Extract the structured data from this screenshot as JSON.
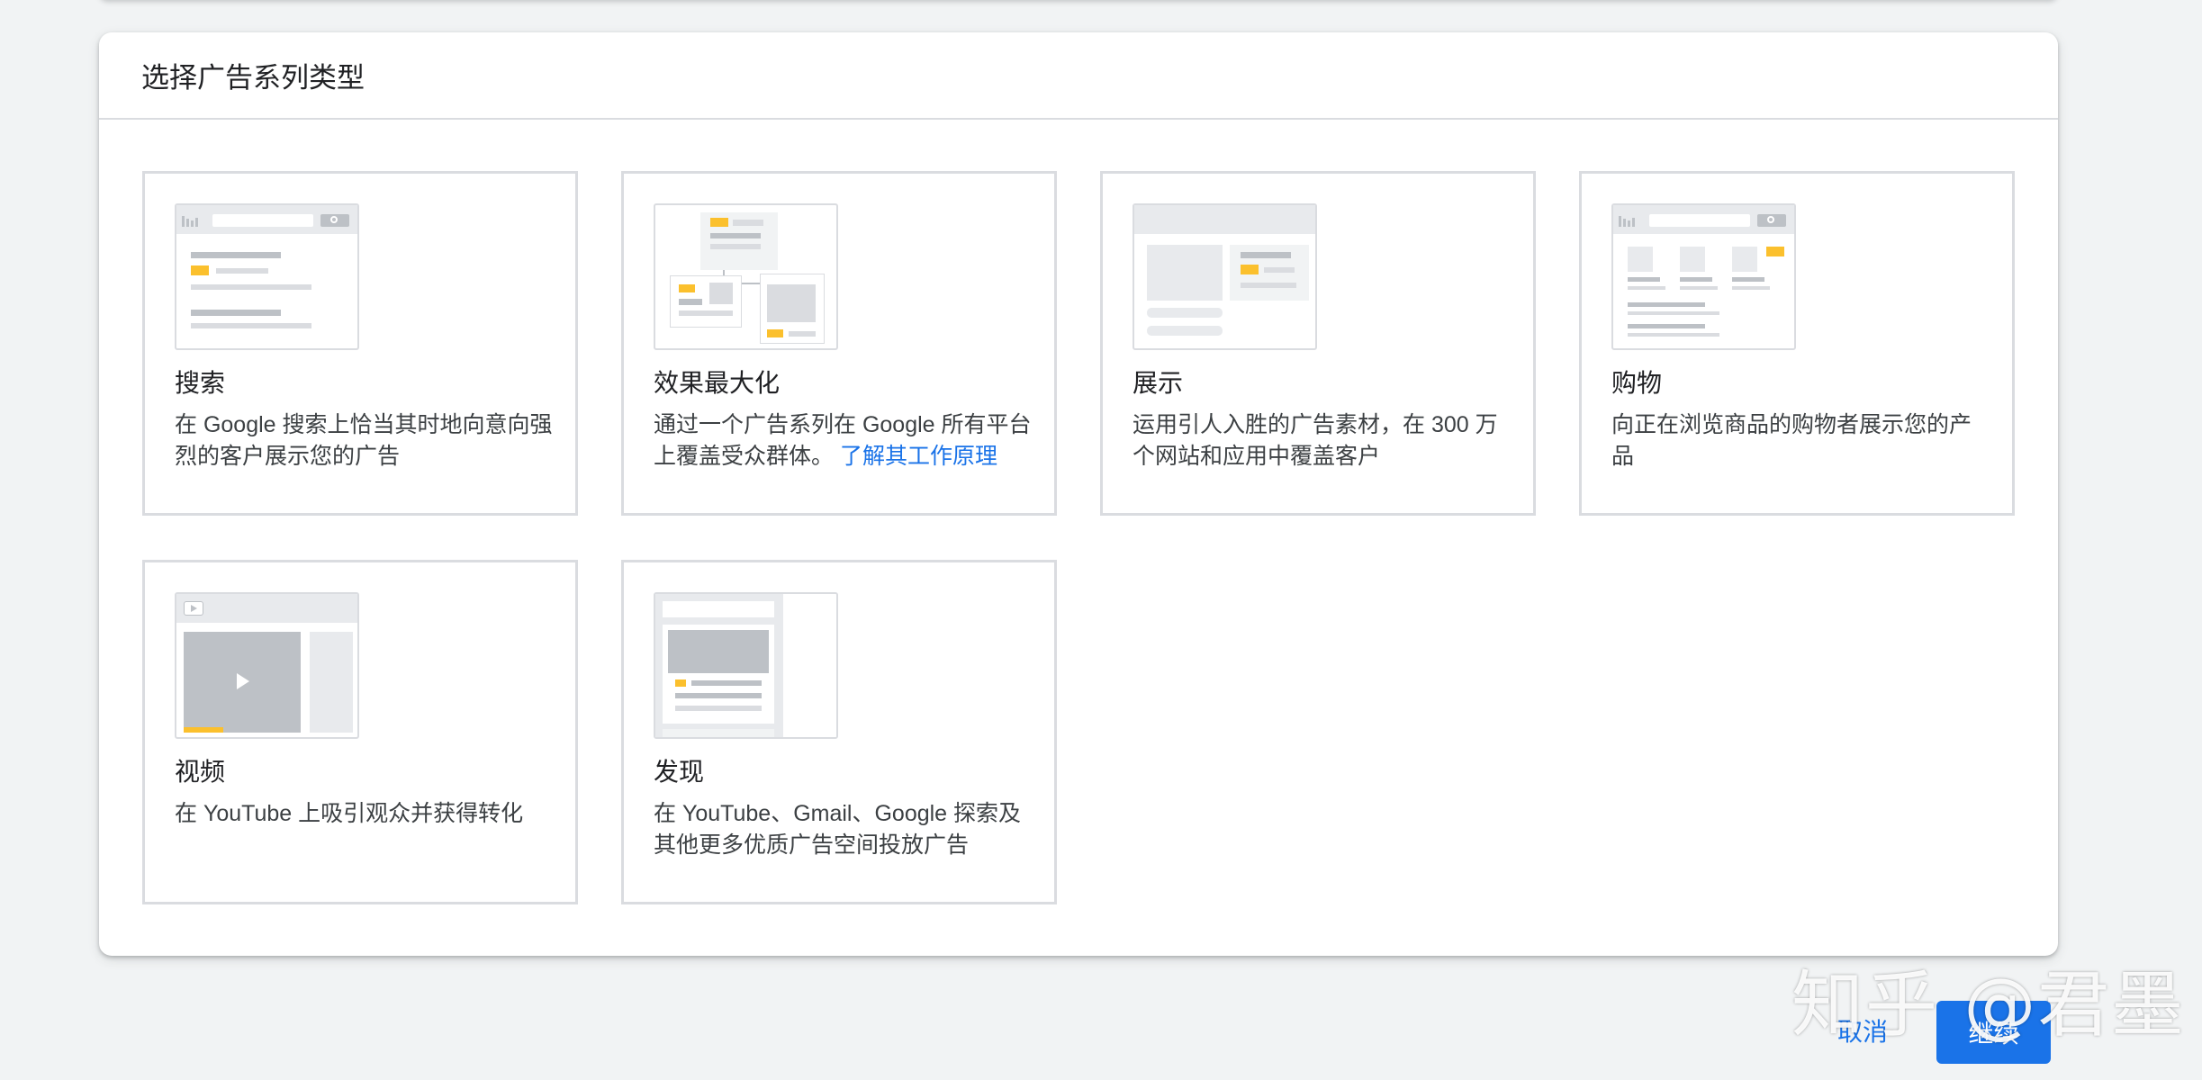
{
  "dialog": {
    "title": "选择广告系列类型"
  },
  "campaign_types": [
    {
      "title": "搜索",
      "description": "在 Google 搜索上恰当其时地向意向强烈的客户展示您的广告",
      "icon": "search-campaign-illustration"
    },
    {
      "title": "效果最大化",
      "description": "通过一个广告系列在 Google 所有平台上覆盖受众群体。",
      "link": "了解其工作原理",
      "icon": "performance-max-illustration"
    },
    {
      "title": "展示",
      "description": "运用引人入胜的广告素材，在 300 万个网站和应用中覆盖客户",
      "icon": "display-campaign-illustration"
    },
    {
      "title": "购物",
      "description": "向正在浏览商品的购物者展示您的产品",
      "icon": "shopping-campaign-illustration"
    },
    {
      "title": "视频",
      "description": "在 YouTube 上吸引观众并获得转化",
      "icon": "video-campaign-illustration"
    },
    {
      "title": "发现",
      "description": "在 YouTube、Gmail、Google 探索及其他更多优质广告空间投放广告",
      "icon": "discovery-campaign-illustration"
    }
  ],
  "actions": {
    "cancel_label": "取消",
    "continue_label": "继续"
  },
  "watermark": "知乎 @君墨",
  "colors": {
    "accent": "#1a73e8",
    "highlight": "#fbc02d",
    "border": "#dadce0",
    "background": "#f1f3f4"
  }
}
